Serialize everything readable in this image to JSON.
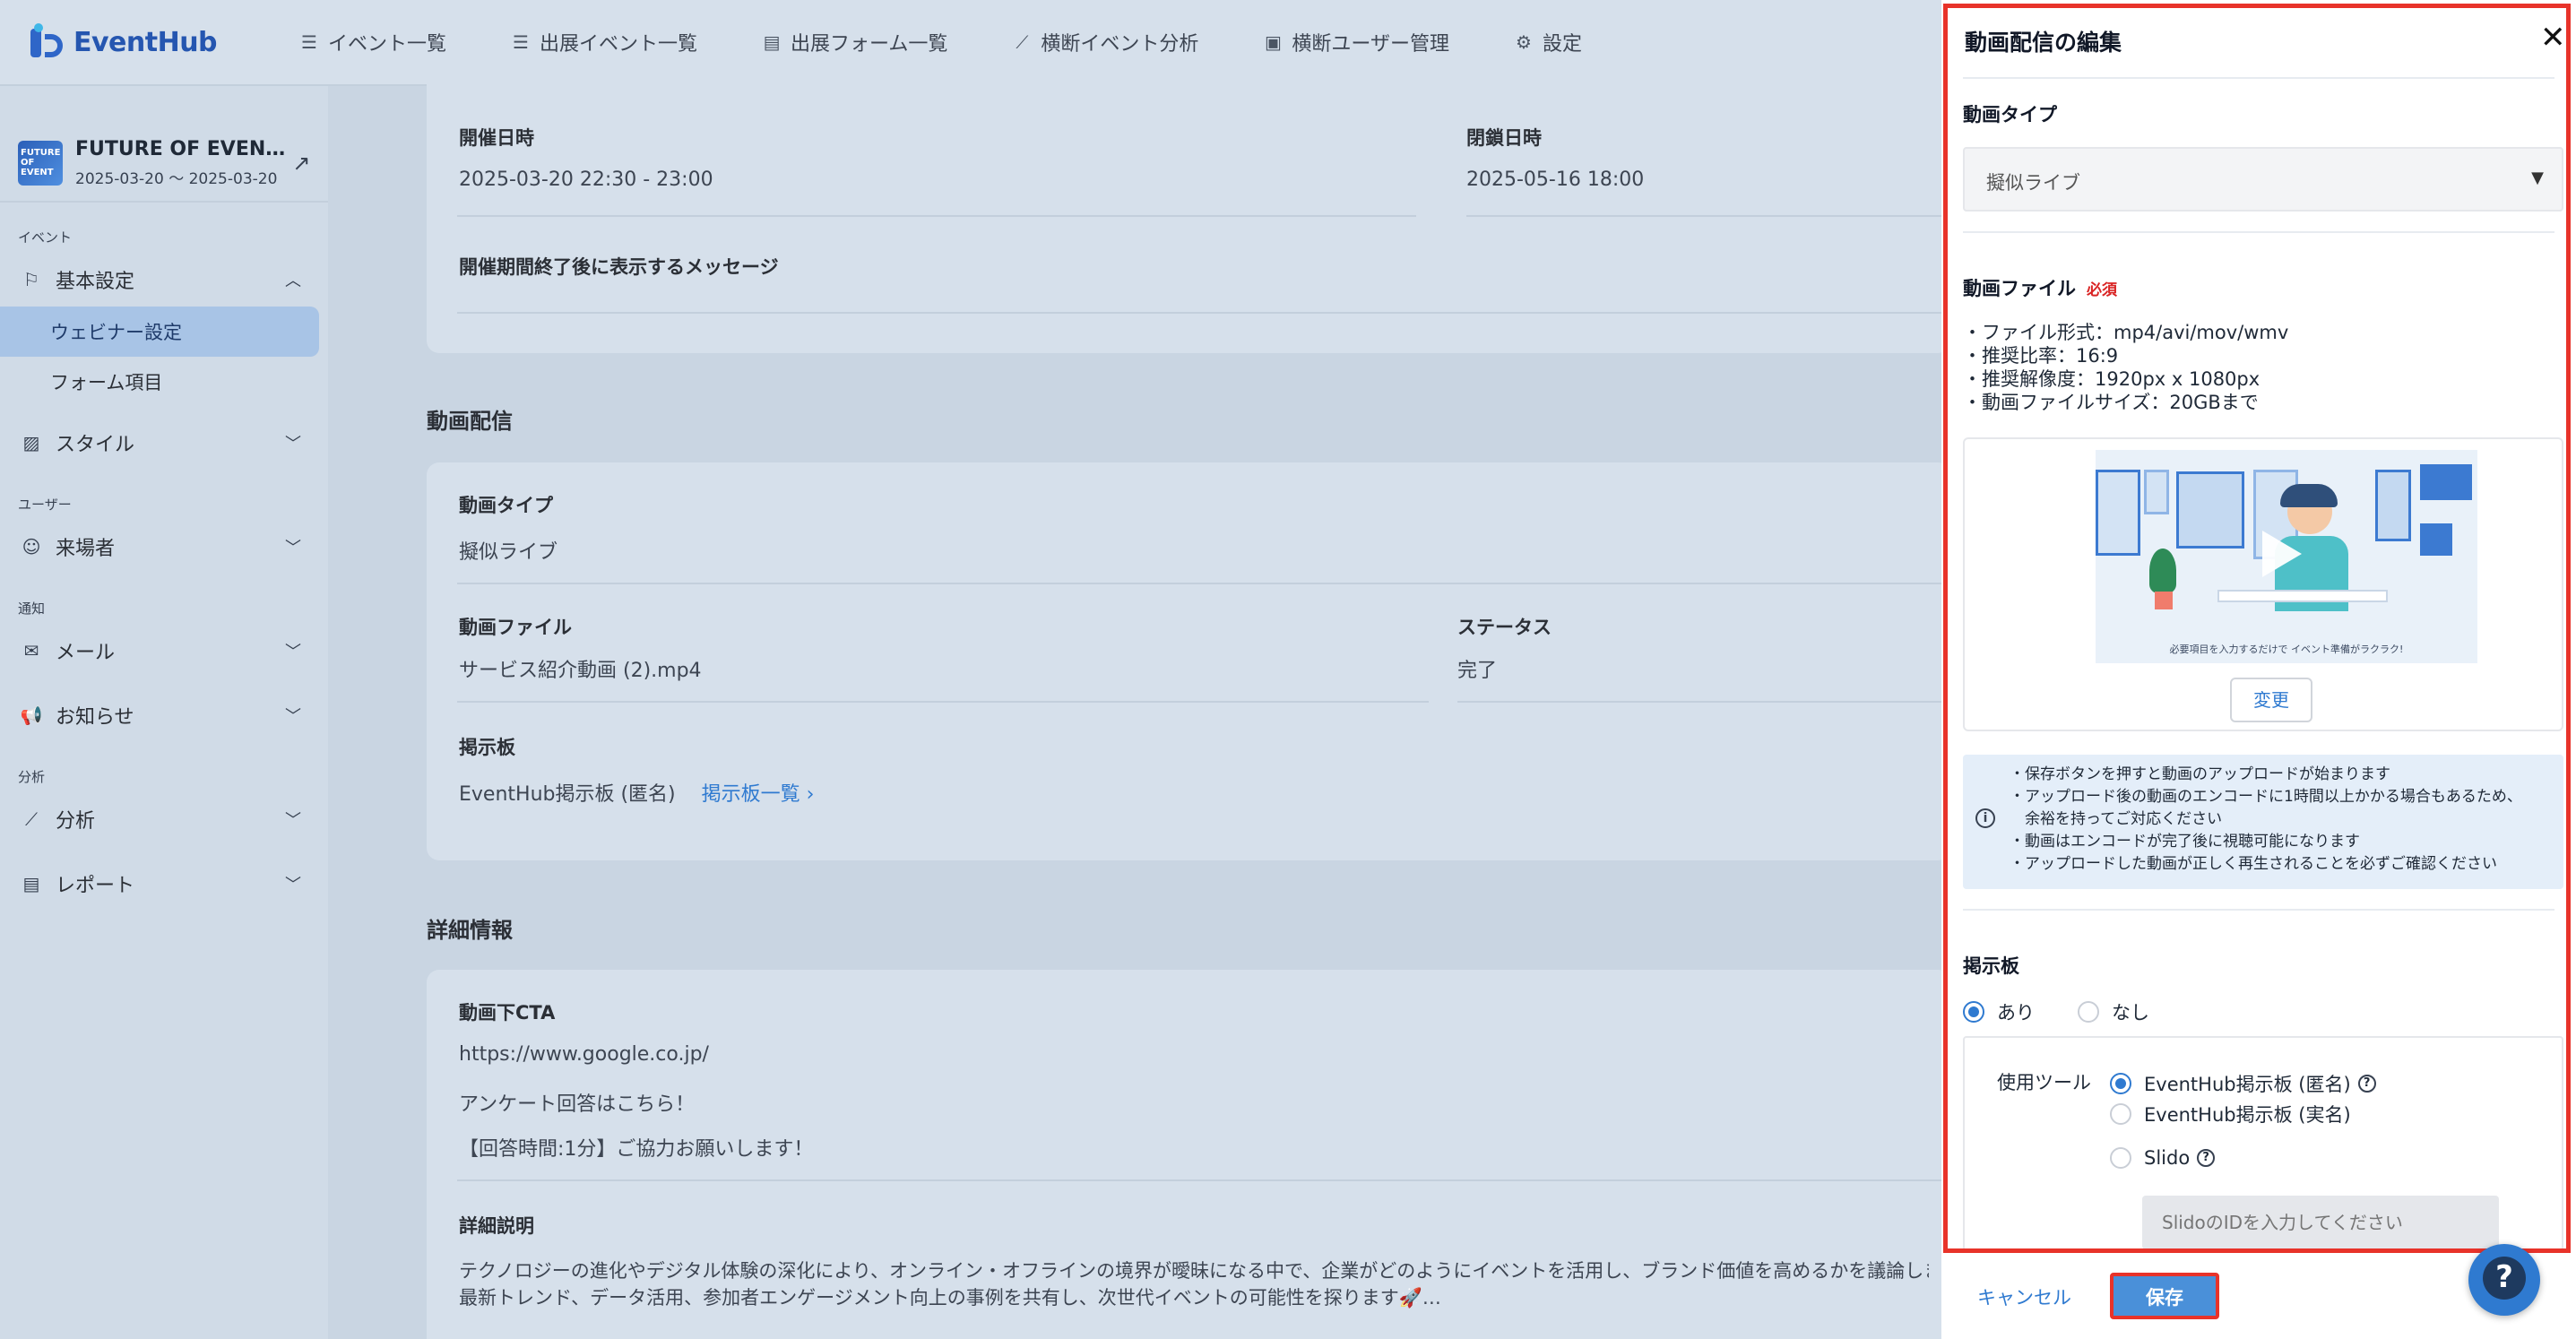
{
  "app": {
    "name": "EventHub"
  },
  "nav": {
    "items": [
      {
        "icon": "list-icon",
        "label": "イベント一覧"
      },
      {
        "icon": "list-icon",
        "label": "出展イベント一覧"
      },
      {
        "icon": "form-icon",
        "label": "出展フォーム一覧"
      },
      {
        "icon": "chart-icon",
        "label": "横断イベント分析"
      },
      {
        "icon": "user-card-icon",
        "label": "横断ユーザー管理"
      },
      {
        "icon": "gear-icon",
        "label": "設定"
      }
    ]
  },
  "sidebar": {
    "event": {
      "thumb_text": "FUTURE OF EVENT",
      "name": "FUTURE OF EVEN…",
      "dates": "2025-03-20 〜 2025-03-20"
    },
    "sections": {
      "event": "イベント",
      "user": "ユーザー",
      "notice": "通知",
      "analysis": "分析"
    },
    "items": {
      "basic": "基本設定",
      "webinar": "ウェビナー設定",
      "form": "フォーム項目",
      "style": "スタイル",
      "visitors": "来場者",
      "mail": "メール",
      "news": "お知らせ",
      "analytics": "分析",
      "report": "レポート"
    }
  },
  "main": {
    "schedule": {
      "open_label": "開催日時",
      "open_value": "2025-03-20 22:30 - 23:00",
      "close_label": "閉鎖日時",
      "close_value": "2025-05-16 18:00",
      "message_label": "開催期間終了後に表示するメッセージ"
    },
    "video": {
      "section_title": "動画配信",
      "type_label": "動画タイプ",
      "type_value": "擬似ライブ",
      "file_label": "動画ファイル",
      "file_value": "サービス紹介動画 (2).mp4",
      "status_label": "ステータス",
      "status_value": "完了",
      "board_label": "掲示板",
      "board_value": "EventHub掲示板 (匿名)",
      "board_link": "掲示板一覧"
    },
    "details": {
      "section_title": "詳細情報",
      "cta_label": "動画下CTA",
      "cta_url": "https://www.google.co.jp/",
      "cta_line1": "アンケート回答はこちら！",
      "cta_line2": "【回答時間:1分】ご協力お願いします！",
      "desc_label": "詳細説明",
      "desc_line1": "テクノロジーの進化やデジタル体験の深化により、オンライン・オフラインの境界が曖昧になる中で、企業がどのようにイベントを活用し、ブランド価値を高めるかを議論しま",
      "desc_line2": "最新トレンド、データ活用、参加者エンゲージメント向上の事例を共有し、次世代イベントの可能性を探ります🚀…"
    }
  },
  "panel": {
    "title": "動画配信の編集",
    "type_label": "動画タイプ",
    "type_value": "擬似ライブ",
    "file_label": "動画ファイル",
    "required": "必須",
    "specs": [
      "・ファイル形式：mp4/avi/mov/wmv",
      "・推奨比率：16:9",
      "・推奨解像度：1920px x 1080px",
      "・動画ファイルサイズ：20GBまで"
    ],
    "thumb_caption": "必要項目を入力するだけで イベント準備がラクラク!",
    "change_button": "変更",
    "info": [
      "・保存ボタンを押すと動画のアップロードが始まります",
      "・アップロード後の動画のエンコードに1時間以上かかる場合もあるため、",
      "　余裕を持ってご対応ください",
      "・動画はエンコードが完了後に視聴可能になります",
      "・アップロードした動画が正しく再生されることを必ずご確認ください"
    ],
    "board_label": "掲示板",
    "board_yes": "あり",
    "board_no": "なし",
    "tool_label": "使用ツール",
    "tool_anon": "EventHub掲示板 (匿名)",
    "tool_real": "EventHub掲示板 (実名)",
    "tool_slido": "Slido",
    "slido_placeholder": "SlidoのIDを入力してください",
    "cancel": "キャンセル",
    "save": "保存"
  }
}
